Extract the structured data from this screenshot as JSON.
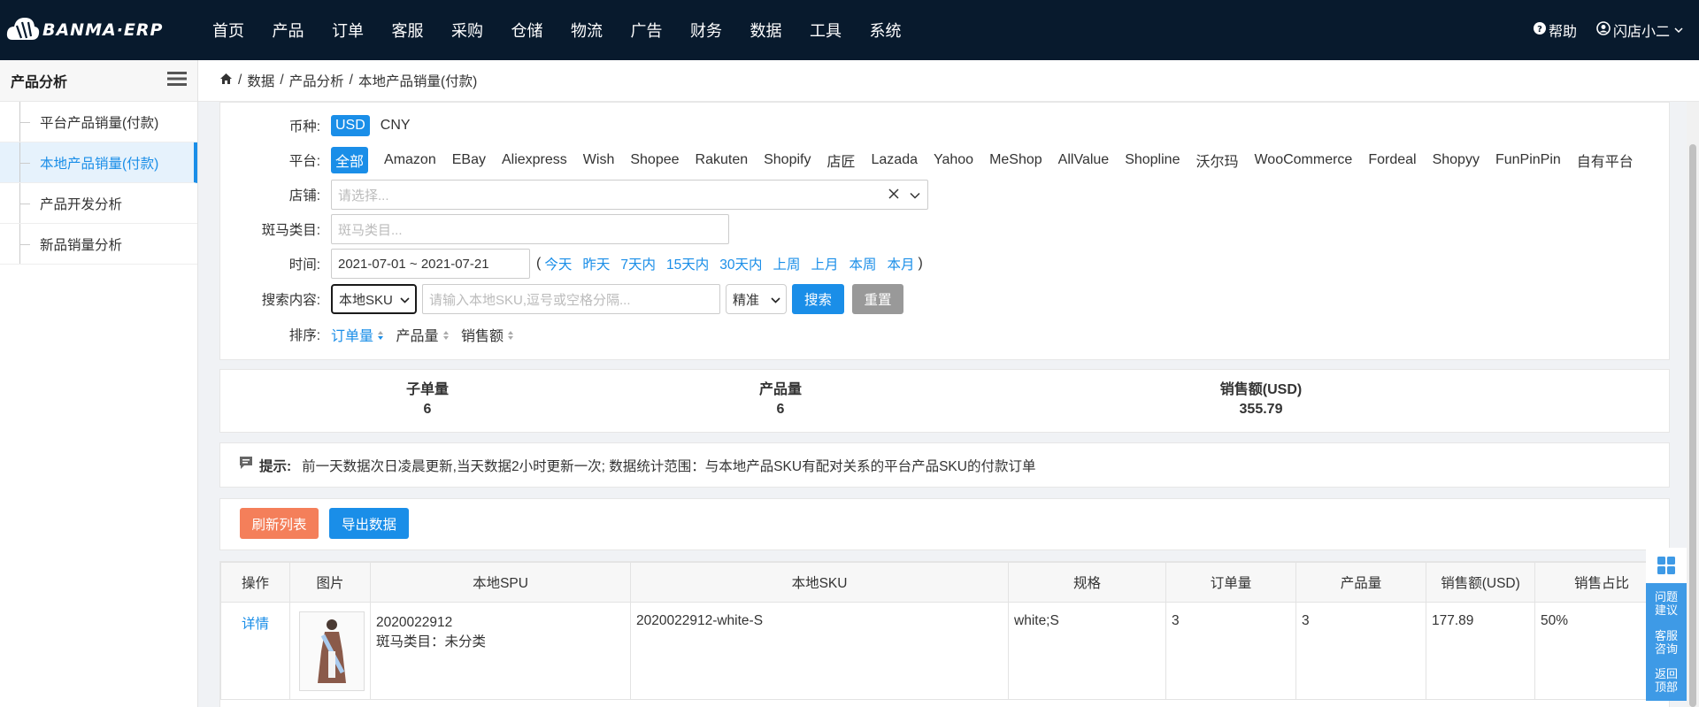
{
  "topnav": {
    "logo_text": "BANMA·ERP",
    "menu": [
      "首页",
      "产品",
      "订单",
      "客服",
      "采购",
      "仓储",
      "物流",
      "广告",
      "财务",
      "数据",
      "工具",
      "系统"
    ],
    "help": "帮助",
    "user": "闪店小二"
  },
  "sidebar": {
    "title": "产品分析",
    "items": [
      "平台产品销量(付款)",
      "本地产品销量(付款)",
      "产品开发分析",
      "新品销量分析"
    ]
  },
  "breadcrumb": [
    "数据",
    "产品分析",
    "本地产品销量(付款)"
  ],
  "filters": {
    "currency_label": "币种:",
    "currencies": [
      "USD",
      "CNY"
    ],
    "platform_label": "平台:",
    "platforms": [
      "全部",
      "Amazon",
      "EBay",
      "Aliexpress",
      "Wish",
      "Shopee",
      "Rakuten",
      "Shopify",
      "店匠",
      "Lazada",
      "Yahoo",
      "MeShop",
      "AllValue",
      "Shopline",
      "沃尔玛",
      "WooCommerce",
      "Fordeal",
      "Shopyy",
      "FunPinPin",
      "自有平台"
    ],
    "store_label": "店铺:",
    "store_placeholder": "请选择...",
    "category_label": "斑马类目:",
    "category_placeholder": "斑马类目...",
    "time_label": "时间:",
    "time_value": "2021-07-01 ~ 2021-07-21",
    "time_open": "(",
    "time_close": ")",
    "time_shortcuts": [
      "今天",
      "昨天",
      "7天内",
      "15天内",
      "30天内",
      "上周",
      "上月",
      "本周",
      "本月"
    ],
    "search_label": "搜索内容:",
    "search_type": "本地SKU",
    "search_placeholder": "请输入本地SKU,逗号或空格分隔...",
    "match_type": "精准",
    "search_btn": "搜索",
    "reset_btn": "重置",
    "sort_label": "排序:",
    "sort_fields": [
      "订单量",
      "产品量",
      "销售额"
    ]
  },
  "stats": [
    {
      "label": "子单量",
      "value": "6"
    },
    {
      "label": "产品量",
      "value": "6"
    },
    {
      "label": "销售额(USD)",
      "value": "355.79"
    }
  ],
  "tip": {
    "title": "提示:",
    "text": "前一天数据次日凌晨更新,当天数据2小时更新一次; 数据统计范围：与本地产品SKU有配对关系的平台产品SKU的付款订单"
  },
  "actions": {
    "refresh": "刷新列表",
    "export": "导出数据"
  },
  "table": {
    "headers": [
      "操作",
      "图片",
      "本地SPU",
      "本地SKU",
      "规格",
      "订单量",
      "产品量",
      "销售额(USD)",
      "销售占比"
    ],
    "rows": [
      {
        "action": "详情",
        "spu": "2020022912",
        "category": "斑马类目：未分类",
        "sku": "2020022912-white-S",
        "spec": "white;S",
        "orders": "3",
        "products": "3",
        "sales": "177.89",
        "share": "50%"
      }
    ]
  },
  "float_tools": [
    "问题建议",
    "客服咨询",
    "返回顶部"
  ],
  "colors": {
    "nav_bg": "#081a2d",
    "primary": "#1a8ee8",
    "orange": "#f47f5a",
    "gray_btn": "#999999"
  }
}
